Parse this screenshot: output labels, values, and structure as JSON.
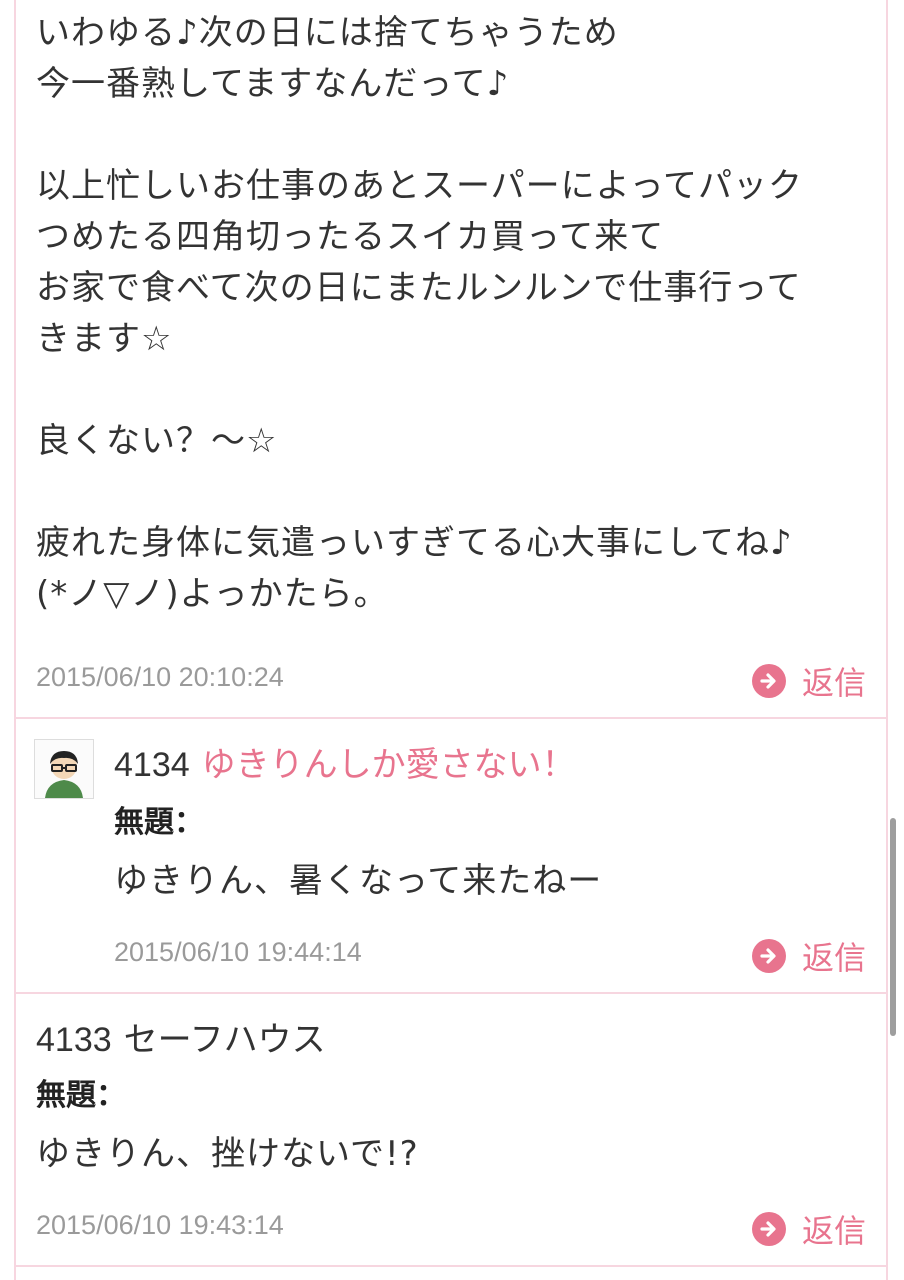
{
  "posts": [
    {
      "body": "いわゆる♪次の日には捨てちゃうため\n今一番熟してますなんだって♪\n\n以上忙しいお仕事のあとスーパーによってパック\nつめたる四角切ったるスイカ買って来て\nお家で食べて次の日にまたルンルンで仕事行って\nきます☆\n\n良くない？～☆\n\n疲れた身体に気遣っいすぎてる心大事にしてね♪\n(*ノ▽ノ)よっかたら。",
      "timestamp": "2015/06/10 20:10:24",
      "reply_label": "返信"
    },
    {
      "number": "4134",
      "author": "ゆきりんしか愛さない！",
      "subject": "無題：",
      "body": "ゆきりん、暑くなって来たねー",
      "timestamp": "2015/06/10 19:44:14",
      "reply_label": "返信"
    },
    {
      "number": "4133",
      "author": "セーフハウス",
      "subject": "無題：",
      "body": "ゆきりん、挫けないで!?",
      "timestamp": "2015/06/10 19:43:14",
      "reply_label": "返信"
    }
  ],
  "icons": {
    "reply": "arrow-right-circle-icon",
    "avatar": "user-avatar-glasses"
  },
  "colors": {
    "accent": "#e8748e",
    "border": "#f7d6e0",
    "text": "#333333",
    "timestamp": "#9a9a9a"
  }
}
